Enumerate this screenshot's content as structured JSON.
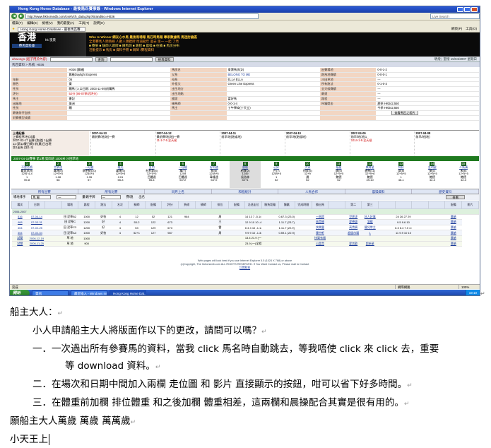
{
  "window": {
    "title": "Hong Kong Horse Database - 最後馬匹賽事錄 - Windows Internet Explorer"
  },
  "browser": {
    "address": "http://www.hkhorsedb.com/cseh/ch_data.php?BrandNo=H036",
    "live_search": "Live Search",
    "menu": [
      "檔案(F)",
      "編輯(E)",
      "檢視(V)",
      "我的最愛(A)",
      "工具(T)",
      "說明(H)"
    ],
    "fav_tab": "Hong Kong Horse Database - 最後馬匹賽...",
    "tools": [
      "網頁(P)",
      "工具(O)"
    ],
    "status_text": "完成",
    "zone": "網際網路",
    "zoom": "100%"
  },
  "site": {
    "logo_big": "香港",
    "logo_small": "賽馬資料庫",
    "hdr_mid": "hk 夜景",
    "banner": [
      "Who Is Winner  網友心水馬  最後馬場報 馬匹時馬報  專家數據馬 馬迷討論區",
      "全港賽馬人頭熱線 人數人頭聽牌 馬道龍年 過去 第一 一起 了然",
      "■ 賽果  ■ 騎師人頭牌  ■ 練馬師  ■ 路程  ■ 晨操 ■ 往績  ■ 馬房分布",
      "活動提示  ■ 馬房  ■ 資料手冊  ■ 騎師 /賽程資料"
    ],
    "user": "ahwong1 (超子用於內容)",
    "search_btn": "查詢",
    "search2_btn": "搜尋資料",
    "right_links": "明燈 | 聖燈 15/04/2007 星期日",
    "breadcrumb": "馬匹資料 > 馬號: H036"
  },
  "horse_info": {
    "rows": [
      [
        "",
        "H036 [晨槍]",
        "馬房名",
        "東寶馬房(D)",
        "出賽場地",
        "0-0-1-2"
      ],
      [
        "",
        "晨槍Daylight Express",
        "父系",
        "BELONG TO ME",
        "跑馬地賽績",
        "0-0-0-1"
      ],
      [
        "年齡",
        "06",
        "母系",
        "ELLA ELLA",
        "沙田草地",
        "---"
      ],
      [
        "顏色",
        "棗",
        "外祖父",
        "Green Line Express",
        "所有跑法",
        "0-1-0-3"
      ],
      [
        "性別",
        "閹馬 (入口日期: 2003-11-09)前購馬",
        "出生地方",
        "",
        "全天候賽績",
        "---"
      ],
      [
        "評分",
        "52分 (06-07季初評分)",
        "出生地點",
        "",
        "最遠",
        "---"
      ],
      [
        "馬主",
        "書記",
        "國家",
        "富好馬",
        "路程",
        "---"
      ],
      [
        "出廠地",
        "美洲",
        "練馬師",
        "0-0-1-4",
        "所獲獎金",
        "歷季 HK$42,550"
      ],
      [
        "性別",
        "閹",
        "馬主",
        "丁午學商(丁天立)",
        "",
        "今季 HK$42,550"
      ],
      [
        "最後前仔血統",
        "",
        "",
        "",
        "",
        ""
      ],
      [
        "對賽模型成績",
        "",
        "",
        "",
        "",
        ""
      ]
    ],
    "photo_btn": "查看馬匹之相片"
  },
  "history": {
    "pedigree_title": "上場紀錄",
    "pedigree": [
      "上賽程序/名(2)場",
      "2007-03-17 出賽 (跑道) 1出賽",
      "11 (第13賽日賽) 前(晨)日出現",
      "第1出馬 (第1-3)"
    ],
    "races": [
      {
        "date": "2007-04-13",
        "lines": [
          "最前賽/地(地)一賽",
          ""
        ]
      },
      {
        "date": "2007-04-12",
        "lines": [
          "最前賽/地(地)一賽",
          "11-1-7-5.全天候"
        ]
      },
      {
        "date": "2007-04-11",
        "lines": [
          "前早/地(跑道地)",
          ""
        ]
      },
      {
        "date": "2007-04-10",
        "lines": [
          "前早/地(跑道地)",
          ""
        ]
      },
      {
        "date": "2007-04-09",
        "lines": [
          "前早/地(地)1",
          "1014-1-9.全天候"
        ]
      },
      {
        "date": "2007-04-08",
        "lines": [
          "前早/地(地)",
          ""
        ]
      }
    ]
  },
  "race_bar": "2007-04-15賽事 第1場 第四班 1000米 沙田草地",
  "runners": [
    {
      "num": "1",
      "name": "不是名將",
      "l2": "戴家邦(9)",
      "l3": "12分 4-4",
      "l4": "1",
      "l5": "59-8"
    },
    {
      "num": "2",
      "name": "世界虎",
      "l2": "韋達(5)",
      "l3": "12+5+5",
      "l4": "1.28",
      "l5": "58"
    },
    {
      "num": "3",
      "name": "一旺驄",
      "l2": "蔡明紹(10)",
      "l3": "1234+5",
      "l4": "1.35",
      "l5": "57"
    },
    {
      "num": "4",
      "name": "雄光",
      "l2": "韋達(5)",
      "l3": "12+5+6",
      "l4": "2:01",
      "l5": "55-3"
    },
    {
      "num": "5",
      "name": "五門",
      "l2": "杜利萊(8)",
      "l3": "12+5+5",
      "l4": "巴體達",
      "l5": "55-4"
    },
    {
      "num": "6",
      "name": "一旺驄",
      "l2": "萬(7)",
      "l3": "1249",
      "l4": "巴體達",
      "l5": "54+2"
    },
    {
      "num": "7",
      "name": "好利道",
      "l2": "蔡(8)",
      "l3": "1249+5",
      "l4": "韋隆遠",
      "l5": "54+2"
    },
    {
      "num": "8",
      "name": "晨槍",
      "l2": "柏寶(2)",
      "l3": "1249",
      "l4": "吳浩林",
      "l5": "52+1"
    },
    {
      "num": "9",
      "name": "心好",
      "l2": "巴(7)",
      "l3": "1249+5",
      "l4": "1",
      "l5": "52"
    },
    {
      "num": "10",
      "name": "大家",
      "l2": "何家(5)",
      "l3": "12+9",
      "l4": "晨",
      "l5": "52"
    },
    {
      "num": "11",
      "name": "福星",
      "l2": "姚(5)",
      "l3": "12+5+5",
      "l4": "鮑德",
      "l5": "52"
    },
    {
      "num": "12",
      "name": "樂財星",
      "l2": "邊柏(11)",
      "l3": "12+9+6",
      "l4": "鮑德",
      "l5": "49-10"
    },
    {
      "num": "13",
      "name": "知好",
      "l2": "邱(8)",
      "l3": "12+5+5",
      "l4": "1",
      "l5": "46-1"
    },
    {
      "num": "14",
      "name": "金明星",
      "l2": "莫(1)",
      "l3": "12+5+5",
      "l4": "鮑德",
      "l5": "42-3"
    },
    {
      "num": "15",
      "name": "人馬溝",
      "l2": "朱(6)",
      "l3": "12+5+5",
      "l4": "鮑德",
      "l5": "42-3"
    }
  ],
  "tabs": [
    "所有出賽",
    "所有比賽",
    "同月上名",
    "和程統計",
    "人馬合作",
    "晨操資料",
    "歷史資料"
  ],
  "filter": {
    "labels": [
      "場地排序",
      "馬 場",
      "一",
      "量/路手牌",
      "一",
      "賽/跑",
      "出名"
    ],
    "go": "查看"
  },
  "results": {
    "headers": [
      "場次",
      "日期",
      "",
      "場地",
      "路程",
      "跑法",
      "名次",
      "騎師",
      "配備",
      "評分",
      "負磅",
      "騎師",
      "排位",
      "配備",
      "沿途走位",
      "勝負距離",
      "獨贏",
      "完成時間",
      "勝出馬",
      "",
      "第二",
      "第三",
      "",
      "",
      "",
      "",
      "配備",
      "影片"
    ],
    "season": "2006-2007",
    "rows": [
      [
        "516",
        "07-04-14",
        "",
        "田 泥草B2",
        "1000",
        "好快",
        "4",
        "12",
        "52",
        "121",
        "964",
        "",
        "周",
        "",
        "14 13 7 -5.1/4",
        "",
        "0.67.3 (23.0)",
        "",
        "一頁蹄",
        "",
        "世界虎",
        "好人好事",
        "",
        "24 26 27 29",
        "",
        "",
        "晨槍"
      ],
      [
        "468",
        "07-03-31",
        "",
        "田 泥草C",
        "1200",
        "好",
        "4",
        "53-2",
        "122",
        "673",
        "",
        "",
        "王",
        "",
        "12 9 10 10 -4.1/4",
        "",
        "1.11.7 (23.7)",
        "",
        "高貴騎",
        "",
        "愛德盛",
        "溫暖",
        "",
        "9.5 9.6 10",
        "",
        "",
        "晨槍"
      ],
      [
        "404",
        "07-02-25",
        "",
        "田 泥草C3",
        "1200",
        "好",
        "4",
        "53",
        "129",
        "673",
        "",
        "",
        "雷",
        "",
        "6 4 4 10 -1.1/2",
        "",
        "1.11.7 (22.9)",
        "",
        "快樂靈",
        "",
        "高貴騎",
        "健兒常主",
        "",
        "6.3 6.4 7.0 4.6",
        "",
        "",
        "晨槍"
      ],
      [
        "354",
        "07-02-04",
        "",
        "田 泥草A3",
        "1000",
        "好快",
        "4",
        "52+1",
        "127",
        "987",
        "",
        "",
        "周",
        "",
        "9 9 9 10 -1.3/4",
        "",
        "0.59.1 (22.9)",
        "",
        "陳中軒",
        "",
        "超級市場",
        "1",
        "",
        "11 9.9 10 10",
        "",
        "",
        "晨槍"
      ],
      [
        "試閘",
        "2006-12-19",
        "",
        "草 地",
        "1000",
        "",
        "",
        "",
        "",
        "",
        "",
        "",
        "",
        "",
        "13.4 21.9 (一)全程",
        "",
        "",
        "",
        "快樂有福",
        "",
        "",
        "",
        "",
        "",
        "",
        "",
        "晨槍"
      ],
      [
        "試閘",
        "2006-11-25",
        "",
        "草 地",
        "900",
        "",
        "",
        "",
        "",
        "",
        "",
        "",
        "",
        "",
        "23.9 (一)全程 5 2 6",
        "",
        "",
        "",
        "山富貴",
        "",
        "愛其歡",
        "超新星",
        "",
        "",
        "",
        "",
        "晨槍"
      ]
    ]
  },
  "footer": [
    "Web pages will look best if you use Internet Explorer 5.5 (1024 X 768) or above",
    "(c)Copyright, The hkhorsedb.com ALL RIGHTS RESERVED. If You Want Contact us, Please mail to Contact",
    "訂閱和傘"
  ],
  "taskbar": {
    "start": "開始",
    "items": [
      "資訊",
      "最近插入 - Windows Int...",
      "Hong Kong Horse Dat..."
    ],
    "tray": "19:10"
  },
  "letter": {
    "greeting": "船主大人：",
    "intro": "小人申請船主大人將版面作以下的更改，請問可以嗎？",
    "p1a": "一．一次過出所有參賽馬的資料，當我 click 馬名時自動跳去，等我唔使 click 來 click 去，重要",
    "p1b": "等 download 資料。",
    "p2": "二．在場次和日期中間加入兩欄  走位圖  和  影片  直接顯示的按鈕，咁可以省下好多時間。",
    "p3": "三．在體重前加欄  排位體重  和之後加欄  體重相差，這兩欄和晨操配合其實是很有用的。",
    "closing": "願船主大人萬歲  萬歲  萬萬歲",
    "sign": "小天王上"
  }
}
